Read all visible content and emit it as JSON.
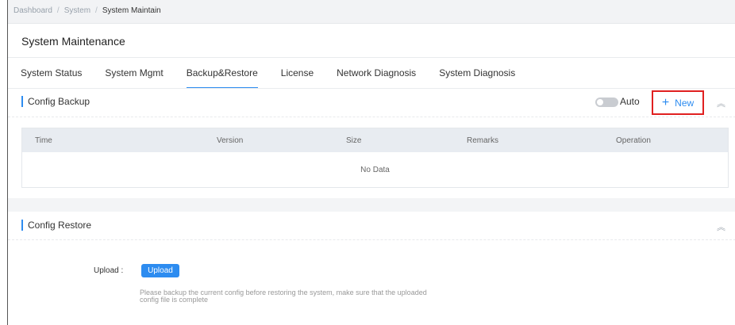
{
  "breadcrumb": {
    "items": [
      "Dashboard",
      "System",
      "System Maintain"
    ],
    "separator": "/"
  },
  "page": {
    "title": "System Maintenance"
  },
  "tabs": [
    {
      "label": "System Status"
    },
    {
      "label": "System Mgmt"
    },
    {
      "label": "Backup&Restore",
      "active": true
    },
    {
      "label": "License"
    },
    {
      "label": "Network Diagnosis"
    },
    {
      "label": "System Diagnosis"
    }
  ],
  "backup": {
    "title": "Config Backup",
    "auto_label": "Auto",
    "auto_enabled": false,
    "new_label": "New",
    "new_icon": "plus-icon",
    "collapse_icon": "double-chevron-up-icon",
    "table": {
      "columns": [
        "Time",
        "Version",
        "Size",
        "Remarks",
        "Operation"
      ],
      "empty_text": "No Data"
    }
  },
  "restore": {
    "title": "Config Restore",
    "collapse_icon": "double-chevron-up-icon",
    "upload_label": "Upload :",
    "upload_button": "Upload",
    "hint_line1": "Please backup the current config before restoring the system, make sure that the uploaded",
    "hint_line2": "config file is complete"
  },
  "colors": {
    "accent": "#2d8cf0",
    "highlight_border": "#e02020",
    "header_bg": "#e8ecf1"
  }
}
